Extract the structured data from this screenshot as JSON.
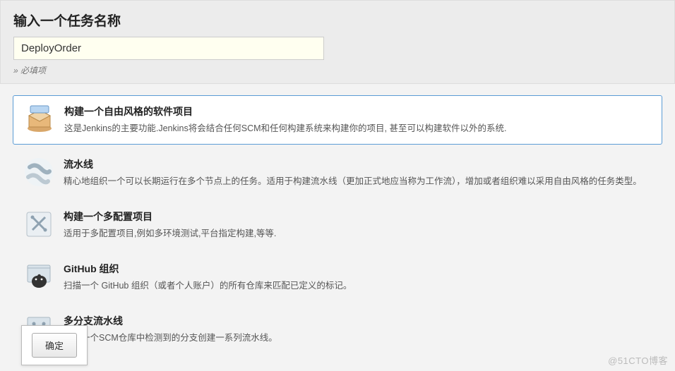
{
  "header": {
    "title": "输入一个任务名称",
    "input_value": "DeployOrder",
    "required_label": "» 必填项"
  },
  "items": [
    {
      "title": "构建一个自由风格的软件项目",
      "desc": "这是Jenkins的主要功能.Jenkins将会结合任何SCM和任何构建系统来构建你的项目, 甚至可以构建软件以外的系统.",
      "selected": true,
      "icon": "freestyle"
    },
    {
      "title": "流水线",
      "desc": "精心地组织一个可以长期运行在多个节点上的任务。适用于构建流水线（更加正式地应当称为工作流），增加或者组织难以采用自由风格的任务类型。",
      "selected": false,
      "icon": "pipeline"
    },
    {
      "title": "构建一个多配置项目",
      "desc": "适用于多配置项目,例如多环境测试,平台指定构建,等等.",
      "selected": false,
      "icon": "multiconfig"
    },
    {
      "title": "GitHub 组织",
      "desc": "扫描一个 GitHub 组织（或者个人账户）的所有仓库来匹配已定义的标记。",
      "selected": false,
      "icon": "github"
    },
    {
      "title": "多分支流水线",
      "desc": "根据一个SCM仓库中检测到的分支创建一系列流水线。",
      "selected": false,
      "icon": "multibranch"
    }
  ],
  "footer": {
    "ok_label": "确定",
    "watermark": "@51CTO博客"
  }
}
